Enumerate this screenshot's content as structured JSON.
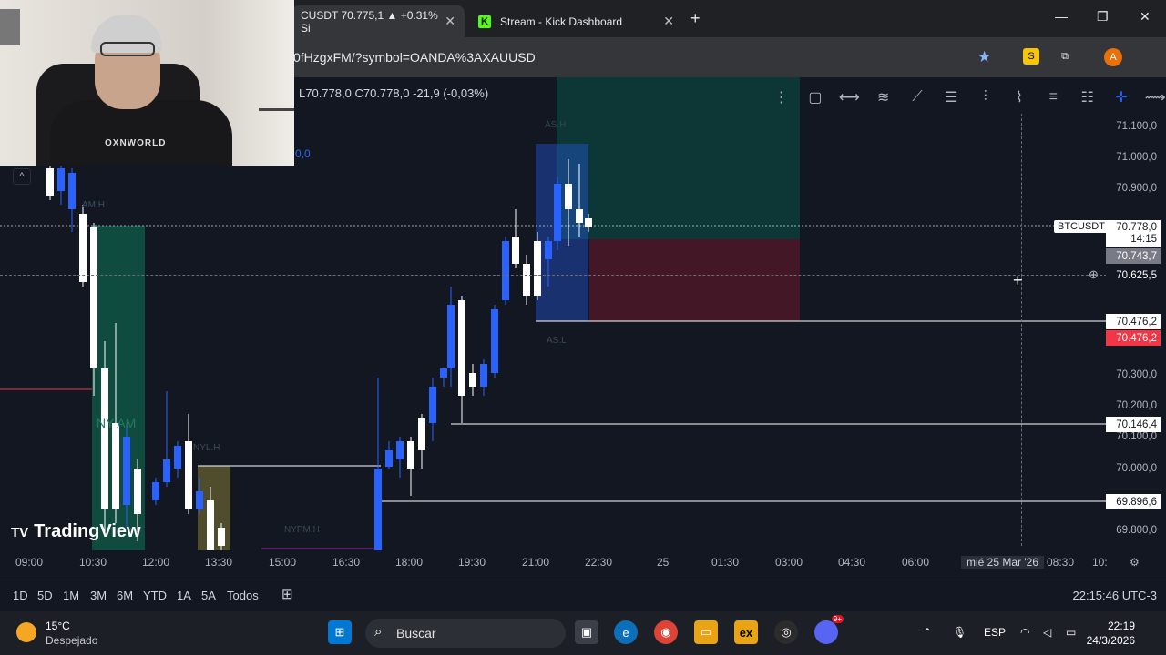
{
  "browser": {
    "tabs": [
      {
        "title": "CUSDT 70.775,1 ▲ +0.31% Si",
        "active": true
      },
      {
        "title": "Stream - Kick Dashboard",
        "active": false
      }
    ],
    "url": "0fHzgxFM/?symbol=OANDA%3AXAUUSD",
    "new_tab": "+",
    "profile_initial": "A",
    "window_controls": [
      "—",
      "❐",
      "✕"
    ]
  },
  "chart": {
    "ohlc": {
      "l_label": "L",
      "l": "70.778,0",
      "c_label": "C",
      "c": "70.778,0",
      "change": "-21,9 (-0,03%)"
    },
    "indicator_value": "0,0",
    "symbol_badge": "BTCUSDT",
    "price_axis": [
      "71.100,0",
      "71.000,0",
      "70.900,0",
      "70.300,0",
      "70.200,0",
      "70.100,0",
      "70.000,0",
      "69.800,0"
    ],
    "price_badges": [
      {
        "value": "70.778,0",
        "sub": "14:15",
        "bg": "#ffffff",
        "fg": "#131722"
      },
      {
        "value": "70.743,7",
        "bg": "#787b86",
        "fg": "#ffffff"
      },
      {
        "value": "70.625,5",
        "bg": "#131722",
        "fg": "#ffffff"
      },
      {
        "value": "70.476,2",
        "bg": "#ffffff",
        "fg": "#131722"
      },
      {
        "value": "70.476,2",
        "bg": "#f23645",
        "fg": "#ffffff"
      },
      {
        "value": "70.146,4",
        "bg": "#ffffff",
        "fg": "#131722"
      },
      {
        "value": "69.896,6",
        "bg": "#ffffff",
        "fg": "#131722"
      }
    ],
    "session_labels": [
      "AM.H",
      "NY AM",
      "NYL.H",
      "NYPM.H",
      "AS.H",
      "AS.L"
    ],
    "time_axis": [
      "09:00",
      "10:30",
      "12:00",
      "13:30",
      "15:00",
      "16:30",
      "18:00",
      "19:30",
      "21:00",
      "22:30",
      "25",
      "01:30",
      "03:00",
      "04:30",
      "06:00",
      "mié 25 Mar '26",
      "08:30",
      "10:"
    ],
    "branding": "TradingView",
    "colors": {
      "up": "#ffffff",
      "down": "#2962ff",
      "bg": "#131722",
      "long_zone": "#0d4a43",
      "short_zone": "#5a1a2a"
    }
  },
  "ranges": [
    "1D",
    "5D",
    "1M",
    "3M",
    "6M",
    "YTD",
    "1A",
    "5A",
    "Todos"
  ],
  "chart_clock": "22:15:46 UTC-3",
  "taskbar": {
    "weather": {
      "temp": "15°C",
      "desc": "Despejado"
    },
    "search_placeholder": "Buscar",
    "language": "ESP",
    "time": "22:19",
    "date": "24/3/2026",
    "discord_badge": "9+"
  },
  "webcam": {
    "shirt_text": "OXNWORLD"
  }
}
